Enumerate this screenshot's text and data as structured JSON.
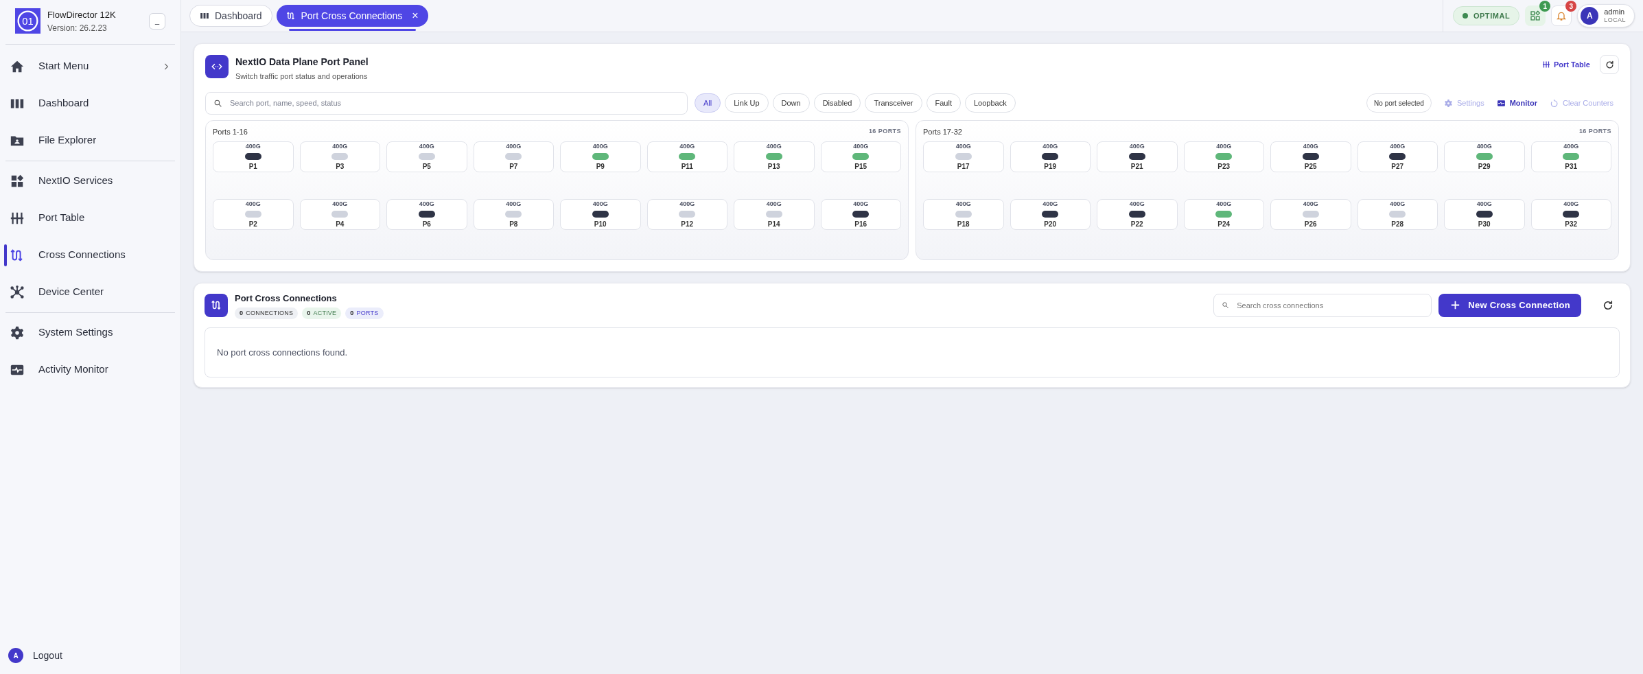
{
  "app": {
    "logo_text": "01",
    "name": "FlowDirector 12K",
    "version": "Version: 26.2.23",
    "collapse_label": "_"
  },
  "sidebar": {
    "items": [
      {
        "kind": "home",
        "label": "Start Menu",
        "selected": false,
        "submenu": true
      },
      {
        "kind": "dashboard",
        "label": "Dashboard",
        "selected": false,
        "submenu": false,
        "divider_after": false
      },
      {
        "kind": "folder",
        "label": "File Explorer",
        "selected": false,
        "submenu": false,
        "divider_after": true
      },
      {
        "kind": "services",
        "label": "NextIO Services",
        "selected": false,
        "submenu": false
      },
      {
        "kind": "sliders",
        "label": "Port Table",
        "selected": false,
        "submenu": false
      },
      {
        "kind": "cross",
        "label": "Cross Connections",
        "selected": true,
        "submenu": false
      },
      {
        "kind": "hub",
        "label": "Device Center",
        "selected": false,
        "submenu": false,
        "divider_after": true
      },
      {
        "kind": "gear",
        "label": "System Settings",
        "selected": false,
        "submenu": false
      },
      {
        "kind": "pulse",
        "label": "Activity Monitor",
        "selected": false,
        "submenu": false
      }
    ],
    "logout": {
      "avatar": "A",
      "label": "Logout"
    }
  },
  "tabs": [
    {
      "kind": "dashboard",
      "label": "Dashboard",
      "selected": false,
      "closable": false
    },
    {
      "kind": "cross",
      "label": "Port Cross Connections",
      "selected": true,
      "closable": true,
      "close": "×"
    }
  ],
  "status": {
    "health": "OPTIMAL",
    "apps_badge": "1",
    "alerts_badge": "3",
    "user": {
      "avatar": "A",
      "name": "admin",
      "realm": "LOCAL"
    }
  },
  "port_panel": {
    "title": "NextIO Data Plane Port Panel",
    "subtitle": "Switch traffic port status and operations",
    "port_table_link": "Port Table",
    "search": {
      "placeholder": "Search port, name, speed, status"
    },
    "filters": [
      {
        "label": "All",
        "selected": true
      },
      {
        "label": "Link Up",
        "selected": false
      },
      {
        "label": "Down",
        "selected": false
      },
      {
        "label": "Disabled",
        "selected": false
      },
      {
        "label": "Transceiver",
        "selected": false
      },
      {
        "label": "Fault",
        "selected": false
      },
      {
        "label": "Loopback",
        "selected": false
      }
    ],
    "selection": "No port selected",
    "actions": [
      {
        "kind": "gear",
        "label": "Settings",
        "disabled": true
      },
      {
        "kind": "pulse",
        "label": "Monitor",
        "disabled": false
      },
      {
        "kind": "reset",
        "label": "Clear Counters",
        "disabled": true
      }
    ],
    "groups": [
      {
        "title": "Ports 1-16",
        "count": "16 PORTS",
        "rows": [
          [
            {
              "speed": "400G",
              "color": "#2f3446",
              "name": "P1"
            },
            {
              "speed": "400G",
              "color": "#cfd3dd",
              "name": "P3"
            },
            {
              "speed": "400G",
              "color": "#cfd3dd",
              "name": "P5"
            },
            {
              "speed": "400G",
              "color": "#cfd3dd",
              "name": "P7"
            },
            {
              "speed": "400G",
              "color": "#5fb77a",
              "name": "P9"
            },
            {
              "speed": "400G",
              "color": "#5fb77a",
              "name": "P11"
            },
            {
              "speed": "400G",
              "color": "#5fb77a",
              "name": "P13"
            },
            {
              "speed": "400G",
              "color": "#5fb77a",
              "name": "P15"
            }
          ],
          [
            {
              "speed": "400G",
              "color": "#cfd3dd",
              "name": "P2"
            },
            {
              "speed": "400G",
              "color": "#cfd3dd",
              "name": "P4"
            },
            {
              "speed": "400G",
              "color": "#2f3446",
              "name": "P6"
            },
            {
              "speed": "400G",
              "color": "#cfd3dd",
              "name": "P8"
            },
            {
              "speed": "400G",
              "color": "#2f3446",
              "name": "P10"
            },
            {
              "speed": "400G",
              "color": "#cfd3dd",
              "name": "P12"
            },
            {
              "speed": "400G",
              "color": "#cfd3dd",
              "name": "P14"
            },
            {
              "speed": "400G",
              "color": "#2f3446",
              "name": "P16"
            }
          ]
        ]
      },
      {
        "title": "Ports 17-32",
        "count": "16 PORTS",
        "rows": [
          [
            {
              "speed": "400G",
              "color": "#cfd3dd",
              "name": "P17"
            },
            {
              "speed": "400G",
              "color": "#2f3446",
              "name": "P19"
            },
            {
              "speed": "400G",
              "color": "#2f3446",
              "name": "P21"
            },
            {
              "speed": "400G",
              "color": "#5fb77a",
              "name": "P23"
            },
            {
              "speed": "400G",
              "color": "#2f3446",
              "name": "P25"
            },
            {
              "speed": "400G",
              "color": "#2f3446",
              "name": "P27"
            },
            {
              "speed": "400G",
              "color": "#5fb77a",
              "name": "P29"
            },
            {
              "speed": "400G",
              "color": "#5fb77a",
              "name": "P31"
            }
          ],
          [
            {
              "speed": "400G",
              "color": "#cfd3dd",
              "name": "P18"
            },
            {
              "speed": "400G",
              "color": "#2f3446",
              "name": "P20"
            },
            {
              "speed": "400G",
              "color": "#2f3446",
              "name": "P22"
            },
            {
              "speed": "400G",
              "color": "#5fb77a",
              "name": "P24"
            },
            {
              "speed": "400G",
              "color": "#cfd3dd",
              "name": "P26"
            },
            {
              "speed": "400G",
              "color": "#cfd3dd",
              "name": "P28"
            },
            {
              "speed": "400G",
              "color": "#2f3446",
              "name": "P30"
            },
            {
              "speed": "400G",
              "color": "#2f3446",
              "name": "P32"
            }
          ]
        ]
      }
    ]
  },
  "cross_panel": {
    "title": "Port Cross Connections",
    "stats": [
      {
        "kind": "connections",
        "value": "0",
        "label": "CONNECTIONS"
      },
      {
        "kind": "active",
        "value": "0",
        "label": "ACTIVE"
      },
      {
        "kind": "ports",
        "value": "0",
        "label": "PORTS"
      }
    ],
    "search": {
      "placeholder": "Search cross connections"
    },
    "new_button": "New Cross Connection",
    "empty": "No port cross connections found."
  }
}
